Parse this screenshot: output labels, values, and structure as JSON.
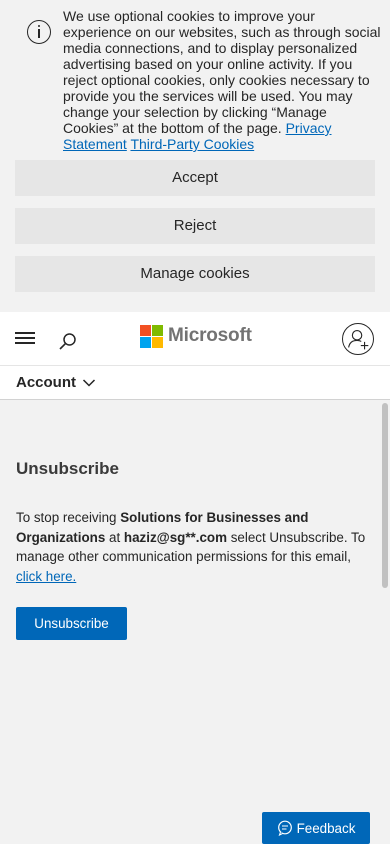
{
  "cookie_banner": {
    "text": "We use optional cookies to improve your experience on our websites, such as through social media connections, and to display personalized advertising based on your online activity. If you reject optional cookies, only cookies necessary to provide you the services will be used. You may change your selection by clicking “Manage Cookies” at the bottom of the page.",
    "privacy_link": "Privacy Statement",
    "third_party_link": "Third-Party Cookies",
    "accept_label": "Accept",
    "reject_label": "Reject",
    "manage_label": "Manage cookies",
    "icon": "info-icon"
  },
  "header": {
    "brand": "Microsoft",
    "menu_icon": "hamburger-icon",
    "search_icon": "search-icon",
    "account_icon": "add-user-icon",
    "logo_colors": [
      "#f25022",
      "#7fba00",
      "#00a4ef",
      "#ffb900"
    ]
  },
  "account_bar": {
    "label": "Account"
  },
  "main": {
    "title": "Unsubscribe",
    "text_prefix": "To stop receiving ",
    "subscription": "Solutions for Businesses and Organizations",
    "text_at": " at ",
    "email": "haziz@sg**.com",
    "text_suffix": " select Unsubscribe. To manage other communication permissions for this email, ",
    "link": "click here.",
    "button_label": "Unsubscribe"
  },
  "feedback": {
    "label": "Feedback"
  },
  "colors": {
    "accent": "#0067b8",
    "background": "#f2f2f2"
  }
}
